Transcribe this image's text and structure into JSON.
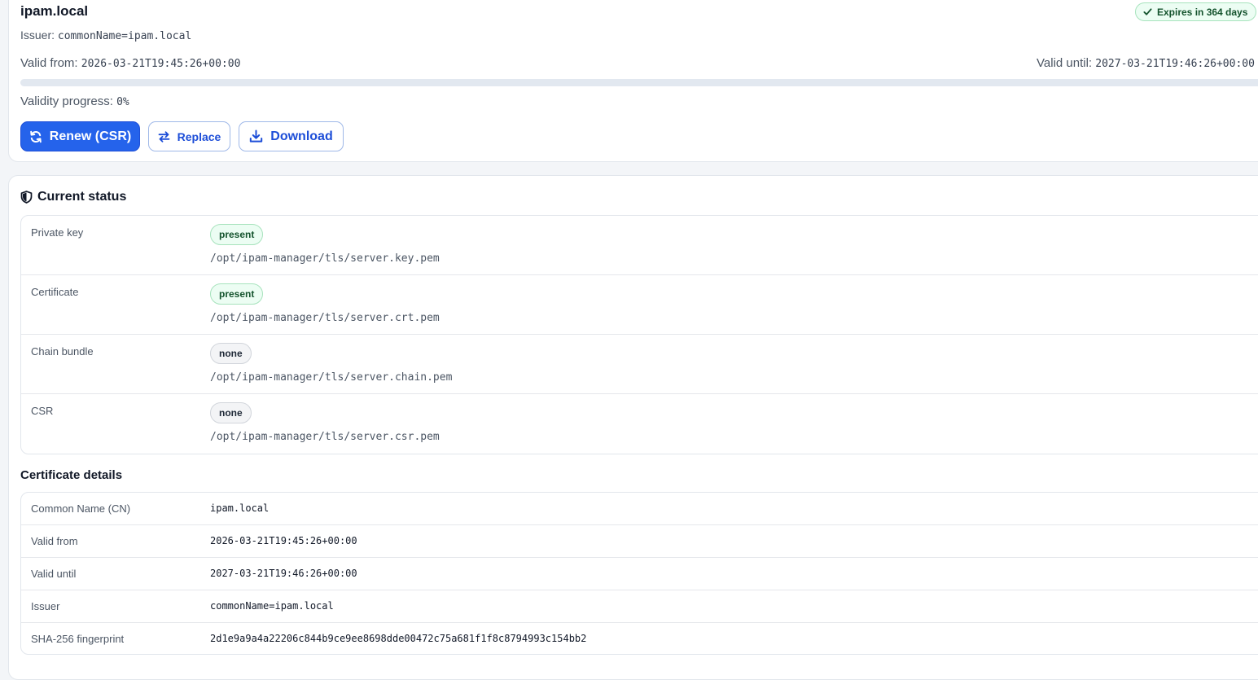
{
  "certificate": {
    "hostname": "ipam.local",
    "issuer_label": "Issuer:",
    "issuer_value": "commonName=ipam.local",
    "expiry_badge": "Expires in 364 days",
    "valid_from_label": "Valid from:",
    "valid_from_value": "2026-03-21T19:45:26+00:00",
    "valid_until_label": "Valid until:",
    "valid_until_value": "2027-03-21T19:46:26+00:00",
    "progress_label": "Validity progress:",
    "progress_value": "0%",
    "progress_fraction": 0
  },
  "actions": {
    "renew_label": "Renew (CSR)",
    "replace_label": "Replace",
    "download_label": "Download"
  },
  "status": {
    "title": "Current status",
    "rows": [
      {
        "label": "Private key",
        "state": "present",
        "path": "/opt/ipam-manager/tls/server.key.pem"
      },
      {
        "label": "Certificate",
        "state": "present",
        "path": "/opt/ipam-manager/tls/server.crt.pem"
      },
      {
        "label": "Chain bundle",
        "state": "none",
        "path": "/opt/ipam-manager/tls/server.chain.pem"
      },
      {
        "label": "CSR",
        "state": "none",
        "path": "/opt/ipam-manager/tls/server.csr.pem"
      }
    ]
  },
  "details": {
    "title": "Certificate details",
    "rows": [
      {
        "label": "Common Name (CN)",
        "value": "ipam.local"
      },
      {
        "label": "Valid from",
        "value": "2026-03-21T19:45:26+00:00"
      },
      {
        "label": "Valid until",
        "value": "2027-03-21T19:46:26+00:00"
      },
      {
        "label": "Issuer",
        "value": "commonName=ipam.local"
      },
      {
        "label": "SHA-256 fingerprint",
        "value": "2d1e9a9a4a22206c844b9ce9ee8698dde00472c75a681f1f8c8794993c154bb2"
      }
    ]
  },
  "colors": {
    "primary": "#2563eb",
    "success_bg": "#ecfdf3",
    "success_text": "#14532d",
    "neutral_bg": "#f3f4f6"
  },
  "icons": {
    "expiry": "check-icon",
    "renew": "refresh-icon",
    "replace": "swap-arrows-icon",
    "download": "download-icon",
    "status": "shield-icon"
  }
}
